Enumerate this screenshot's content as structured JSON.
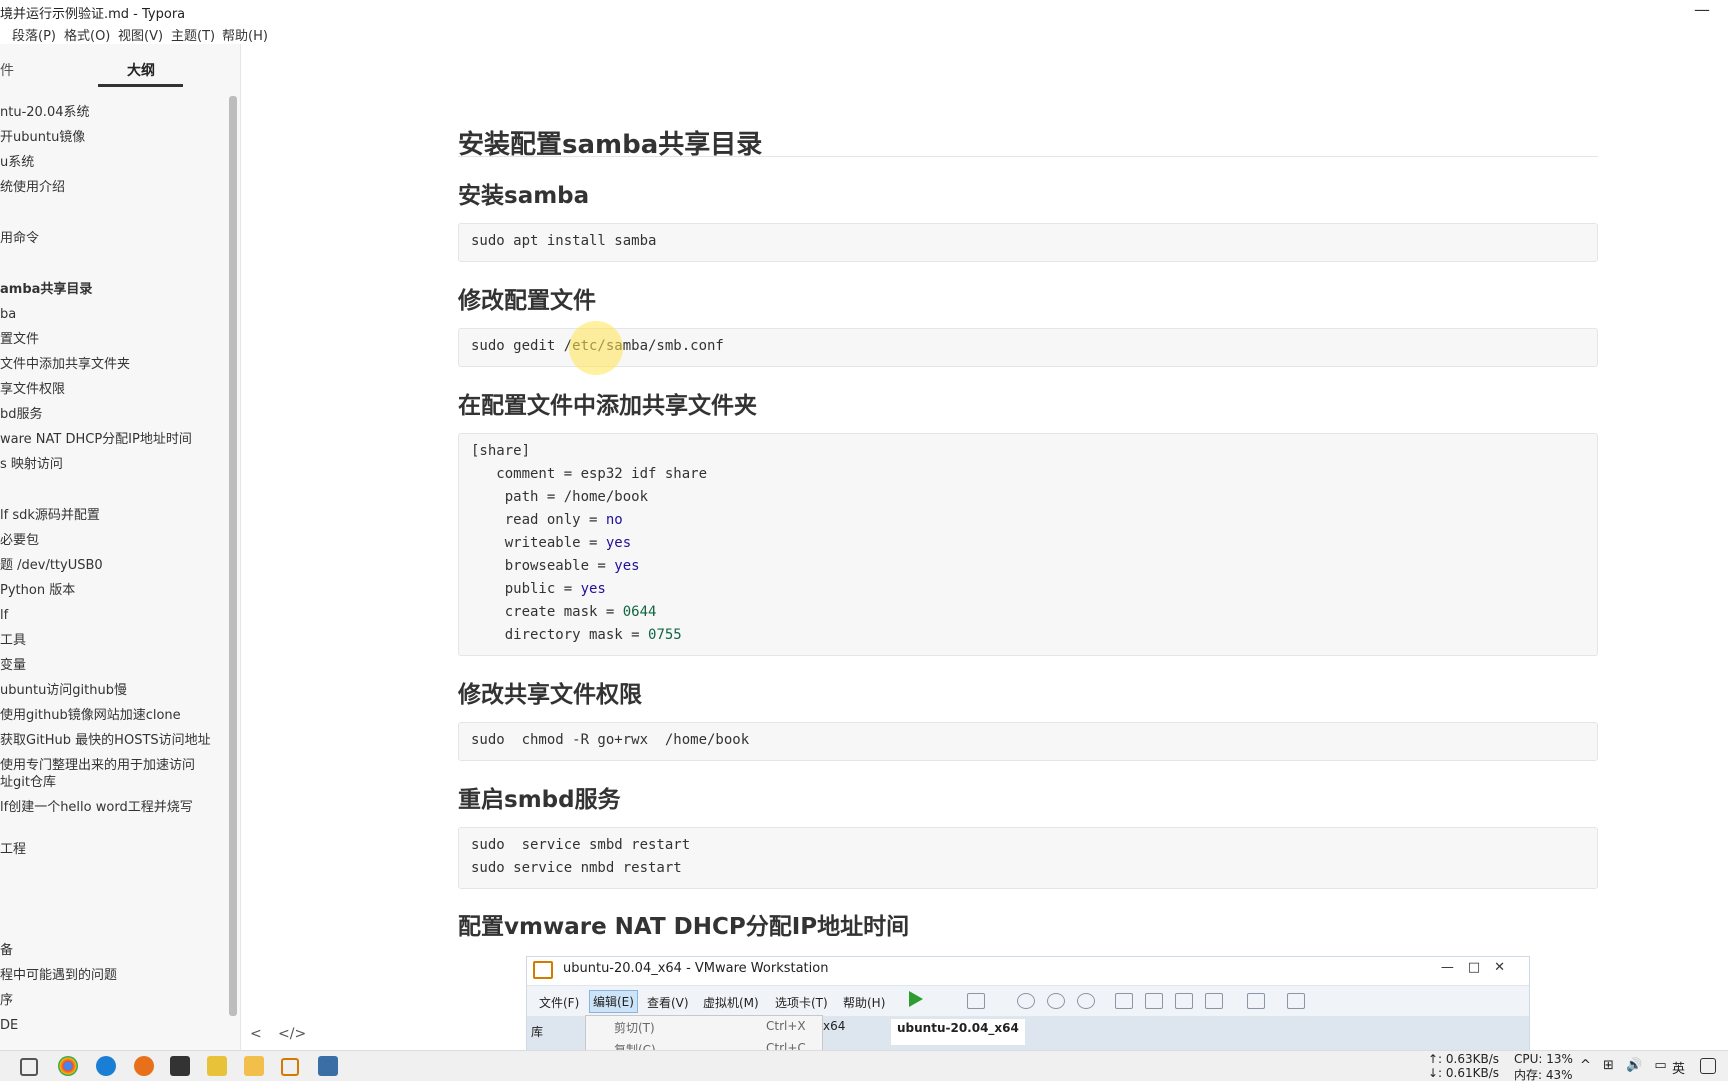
{
  "window": {
    "title": "境并运行示例验证.md - Typora",
    "minimize_glyph": "—"
  },
  "menu": [
    "段落(P)",
    "格式(O)",
    "视图(V)",
    "主题(T)",
    "帮助(H)"
  ],
  "sidebar": {
    "tabs": [
      "件",
      "大纲"
    ],
    "outline": [
      "ntu-20.04系统",
      "开ubuntu镜像",
      "u系统",
      "统使用介绍",
      "用命令",
      "amba共享目录",
      "ba",
      "置文件",
      "文件中添加共享文件夹",
      "享文件权限",
      "bd服务",
      "ware NAT DHCP分配IP地址时间",
      "s 映射访问",
      "lf sdk源码并配置",
      "必要包",
      "题 /dev/ttyUSB0",
      "Python 版本",
      "lf",
      "工具",
      "变量",
      "ubuntu访问github慢",
      "使用github镜像网站加速clone",
      "获取GitHub 最快的HOSTS访问地址",
      "使用专门整理出来的用于加速访问",
      "址git仓库",
      "lf创建一个hello word工程并烧写",
      "工程",
      "备",
      "程中可能遇到的问题",
      "序",
      "DE"
    ],
    "nav": {
      "back": "<",
      "source": "</>"
    }
  },
  "document": {
    "h1": "安装配置samba共享目录",
    "sections": [
      {
        "heading": "安装samba",
        "code": [
          "sudo apt install samba"
        ]
      },
      {
        "heading": "修改配置文件",
        "code": [
          "sudo gedit /etc/samba/smb.conf"
        ]
      },
      {
        "heading": "在配置文件中添加共享文件夹",
        "code_pairs": [
          [
            "[share]",
            ""
          ],
          [
            "   comment = ",
            "esp32 idf share"
          ],
          [
            "    path = ",
            "/home/book"
          ],
          [
            "    read only = ",
            "no"
          ],
          [
            "    writeable = ",
            "yes"
          ],
          [
            "    browseable = ",
            "yes"
          ],
          [
            "    public = ",
            "yes"
          ],
          [
            "    create mask = ",
            "0644"
          ],
          [
            "    directory mask = ",
            "0755"
          ]
        ]
      },
      {
        "heading": "修改共享文件权限",
        "code": [
          "sudo  chmod -R go+rwx  /home/book"
        ]
      },
      {
        "heading": "重启smbd服务",
        "code": [
          "sudo  service smbd restart",
          "sudo service nmbd restart"
        ]
      },
      {
        "heading": "配置vmware NAT DHCP分配IP地址时间"
      }
    ]
  },
  "vmware": {
    "title": "ubuntu-20.04_x64 - VMware Workstation",
    "menu": [
      "文件(F)",
      "编辑(E)",
      "查看(V)",
      "虚拟机(M)",
      "选项卡(T)",
      "帮助(H)"
    ],
    "library": "库",
    "tab_partial": "x64",
    "tab_active": "ubuntu-20.04_x64",
    "dropdown": [
      {
        "label": "剪切(T)",
        "shortcut": "Ctrl+X"
      },
      {
        "label": "复制(C)",
        "shortcut": "Ctrl+C"
      }
    ],
    "win_buttons": "—□✕"
  },
  "taskbar": {
    "upload": "↑: 0.63KB/s",
    "download": "↓: 0.61KB/s",
    "cpu": "CPU: 13%",
    "memory": "内存: 43%",
    "ime": "英",
    "tray_icons": "^ ⊞ 🔊 ▭"
  }
}
